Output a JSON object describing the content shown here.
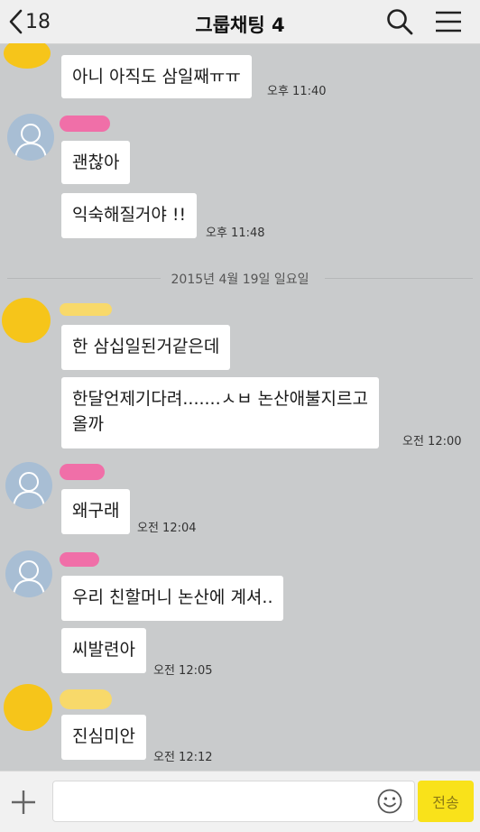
{
  "header": {
    "back_count": "18",
    "title": "그룹채팅 4",
    "icons": [
      "chevron-left-icon",
      "search-icon",
      "menu-icon"
    ]
  },
  "messages": [
    {
      "sender_avatar": "yellow",
      "text": "아니 아직도 삼일째ㅠㅠ",
      "time": "오후 11:40"
    },
    {
      "sender_avatar": "default",
      "text": "괜찮아",
      "time": ""
    },
    {
      "sender_avatar": "default",
      "text": "익숙해질거야 !!",
      "time": "오후 11:48"
    },
    {
      "sender_avatar": "yellow",
      "text": "한 삼십일된거같은데",
      "time": ""
    },
    {
      "sender_avatar": "yellow",
      "text": "한달언제기다려.......ㅅㅂ 논산애불지르고\n올까",
      "time": "오전 12:00"
    },
    {
      "sender_avatar": "default",
      "text": "왜구래",
      "time": "오전 12:04"
    },
    {
      "sender_avatar": "default",
      "text": "우리 친할머니 논산에 계셔..",
      "time": ""
    },
    {
      "sender_avatar": "default",
      "text": "씨발련아",
      "time": "오전 12:05"
    },
    {
      "sender_avatar": "yellow",
      "text": "진심미안",
      "time": "오전 12:12"
    }
  ],
  "date_separator": "2015년 4월 19일 일요일",
  "input_bar": {
    "placeholder": "",
    "send_label": "전송"
  },
  "colors": {
    "background": "#c9cbcc",
    "bubble": "#ffffff",
    "send_button": "#f9e21a",
    "avatar_default": "#a8bed4"
  }
}
